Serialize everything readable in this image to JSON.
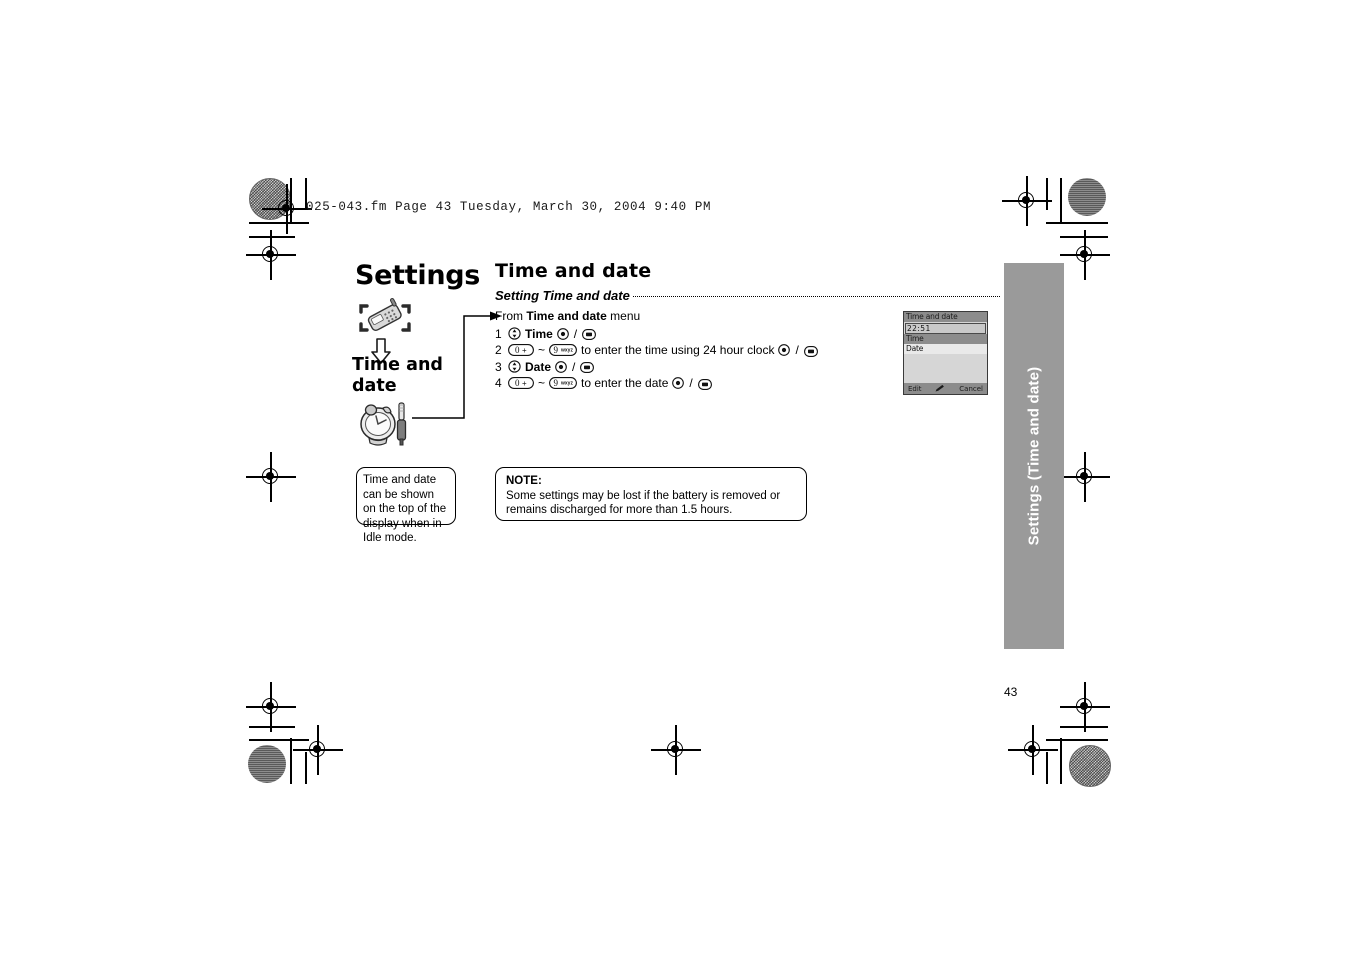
{
  "file_header": "025-043.fm  Page 43  Tuesday, March 30, 2004  9:40 PM",
  "chapter": {
    "title": "Settings",
    "subtitle": "Time and date",
    "phone_icon": "phone-in-brackets-icon",
    "arrow_icon": "down-arrow-icon",
    "illustration_icon": "clock-and-screwdriver-icon"
  },
  "section": {
    "title": "Time and date",
    "sub_heading": "Setting Time and date",
    "from_line_prefix": "From ",
    "from_line_bold": "Time and date",
    "from_line_suffix": " menu",
    "steps": [
      {
        "num": "1",
        "keys_before": "nav-updown-key",
        "label": "Time",
        "text_after": "",
        "keys_after": [
          "ok-key",
          "soft-key"
        ]
      },
      {
        "num": "2",
        "key_from": "0 +",
        "key_range_sep": "~",
        "key_to": "9 wxyz",
        "text_after": "to enter the time using 24 hour clock",
        "keys_after": [
          "ok-key",
          "soft-key"
        ]
      },
      {
        "num": "3",
        "keys_before": "nav-updown-key",
        "label": "Date",
        "text_after": "",
        "keys_after": [
          "ok-key",
          "soft-key"
        ]
      },
      {
        "num": "4",
        "key_from": "0 +",
        "key_range_sep": "~",
        "key_to": "9 wxyz",
        "text_after": "to enter the date",
        "keys_after": [
          "ok-key",
          "soft-key"
        ]
      }
    ],
    "separator": "/"
  },
  "phone_screen": {
    "title": "Time and date",
    "field_value": "22:51",
    "rows": [
      {
        "label": "Time",
        "selected": true
      },
      {
        "label": "Date",
        "selected": false
      }
    ],
    "softkeys": {
      "left": "Edit",
      "center": "pencil-icon",
      "right": "Cancel"
    }
  },
  "callout_left": "Time and date can be shown on the top of the display when in Idle mode.",
  "note": {
    "label": "NOTE:",
    "text": "Some settings may be lost if the battery is removed or remains discharged for more than 1.5 hours."
  },
  "side_tab": {
    "label": "Settings  (Time and date)",
    "color": "#9a9a9a"
  },
  "page_number": "43"
}
